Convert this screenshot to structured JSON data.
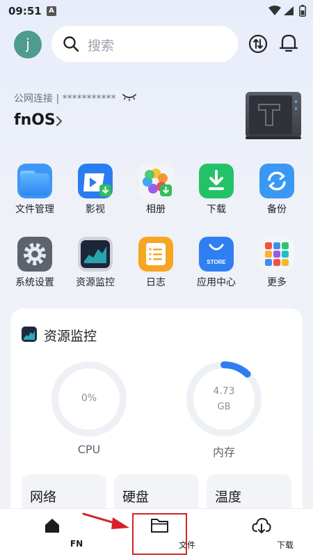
{
  "status_bar": {
    "time": "09:51",
    "notification_badge": "A"
  },
  "header": {
    "avatar_letter": "j",
    "search_placeholder": "搜索",
    "icons": [
      "search-icon",
      "transfer-icon",
      "bell-icon"
    ]
  },
  "device": {
    "connection_label": "公网连接 | ***********",
    "name": "fnOS"
  },
  "apps": [
    {
      "label": "文件管理",
      "icon": "folder-icon"
    },
    {
      "label": "影视",
      "icon": "video-icon"
    },
    {
      "label": "相册",
      "icon": "photos-icon"
    },
    {
      "label": "下载",
      "icon": "download-icon"
    },
    {
      "label": "备份",
      "icon": "backup-icon"
    },
    {
      "label": "系统设置",
      "icon": "settings-icon"
    },
    {
      "label": "资源监控",
      "icon": "monitor-icon"
    },
    {
      "label": "日志",
      "icon": "log-icon"
    },
    {
      "label": "应用中心",
      "icon": "store-icon",
      "badge": "STORE"
    },
    {
      "label": "更多",
      "icon": "more-icon"
    }
  ],
  "resource_card": {
    "title": "资源监控",
    "cpu": {
      "value": "0%",
      "label": "CPU",
      "fraction": 0
    },
    "memory": {
      "value": "4.73",
      "unit": "GB",
      "label": "内存",
      "fraction": 0.12
    },
    "tiles": [
      "网络",
      "硬盘",
      "温度"
    ]
  },
  "bottom_nav": [
    {
      "label": "FN",
      "icon": "home-icon",
      "active": true
    },
    {
      "label": "文件",
      "icon": "folder-outline-icon",
      "active": false
    },
    {
      "label": "下载",
      "icon": "cloud-download-icon",
      "active": false
    }
  ],
  "colors": {
    "accent": "#2f7ef0",
    "highlight": "#d4232b",
    "avatar": "#4f9b8d"
  }
}
